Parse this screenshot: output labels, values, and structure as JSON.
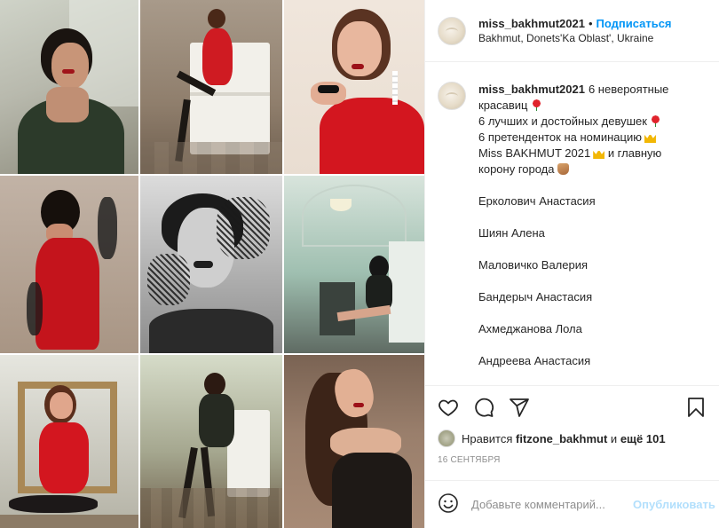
{
  "header": {
    "username": "miss_bakhmut2021",
    "separator": "•",
    "follow_label": "Подписаться",
    "location": "Bakhmut, Donets'Ka Oblast', Ukraine"
  },
  "caption": {
    "username": "miss_bakhmut2021",
    "line1": "6 невероятные красавиц",
    "line2": "6 лучших и достойных девушек",
    "line3": "6 претенденток на номинацию",
    "line4": "Miss BAKHMUT 2021",
    "line5": "и главную корону города",
    "names": [
      "Ерколович Анастасия",
      "Шиян Алена",
      "Маловичко Валерия",
      "Бандерыч Анастасия",
      "Ахмеджанова Лола",
      "Андреева Анастасия"
    ]
  },
  "icons": {
    "like": "heart-icon",
    "comment": "comment-icon",
    "share": "share-icon",
    "save": "bookmark-icon",
    "emoji": "smiley-icon"
  },
  "likes": {
    "prefix": "Нравится",
    "user": "fitzone_bakhmut",
    "and": "и",
    "others": "ещё 101"
  },
  "date": "16 сентября",
  "comment": {
    "placeholder": "Добавьте комментарий...",
    "publish_label": "Опубликовать"
  },
  "colors": {
    "accent": "#0095f6",
    "publish_disabled": "#b2dffc",
    "text": "#262626",
    "muted": "#8e8e8e",
    "border": "#efefef"
  }
}
